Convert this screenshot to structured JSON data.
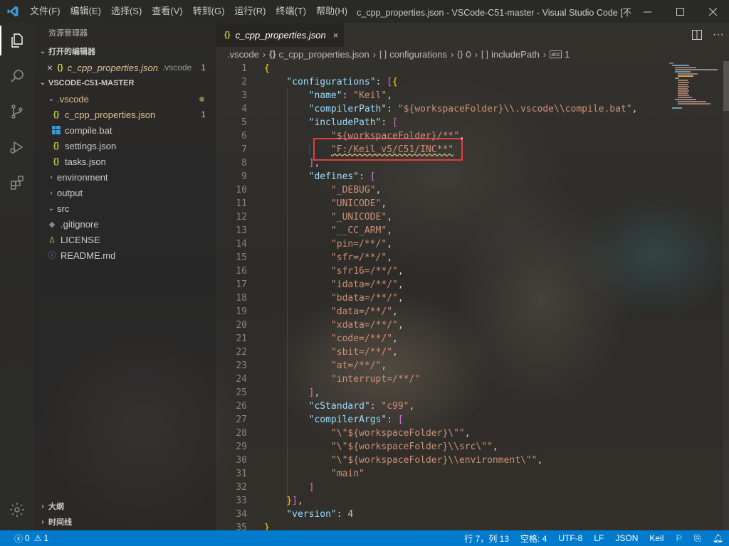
{
  "window": {
    "title": "c_cpp_properties.json - VSCode-C51-master - Visual Studio Code [不...",
    "menu": [
      "文件(F)",
      "编辑(E)",
      "选择(S)",
      "查看(V)",
      "转到(G)",
      "运行(R)",
      "终端(T)",
      "帮助(H)"
    ]
  },
  "sidebar": {
    "header": "资源管理器",
    "open_editors_title": "打开的编辑器",
    "open_editor": {
      "name": "c_cpp_properties.json",
      "folder": ".vscode",
      "problems": "1"
    },
    "workspace_title": "VSCODE-C51-MASTER",
    "tree": [
      {
        "label": ".vscode",
        "type": "folder",
        "badge": "dot"
      },
      {
        "label": "c_cpp_properties.json",
        "type": "json",
        "badge": "1"
      },
      {
        "label": "compile.bat",
        "type": "bat"
      },
      {
        "label": "settings.json",
        "type": "json"
      },
      {
        "label": "tasks.json",
        "type": "json"
      },
      {
        "label": "environment",
        "type": "folder"
      },
      {
        "label": "output",
        "type": "folder"
      },
      {
        "label": "src",
        "type": "folder"
      },
      {
        "label": ".gitignore",
        "type": "git"
      },
      {
        "label": "LICENSE",
        "type": "license"
      },
      {
        "label": "README.md",
        "type": "info"
      }
    ],
    "outline_title": "大纲",
    "timeline_title": "时间线"
  },
  "editor": {
    "tab_label": "c_cpp_properties.json",
    "breadcrumb": [
      ".vscode",
      "c_cpp_properties.json",
      "configurations",
      "0",
      "includePath",
      "1"
    ]
  },
  "code": [
    "{",
    "    \"configurations\": [{",
    "        \"name\": \"Keil\",",
    "        \"compilerPath\": \"${workspaceFolder}\\\\.vscode\\\\compile.bat\",",
    "        \"includePath\": [",
    "            \"${workspaceFolder}/**\",",
    "            \"F:/Keil_v5/C51/INC**\"",
    "        ],",
    "        \"defines\": [",
    "            \"_DEBUG\",",
    "            \"UNICODE\",",
    "            \"_UNICODE\",",
    "            \"__CC_ARM\",",
    "            \"pin=/**/\",",
    "            \"sfr=/**/\",",
    "            \"sfr16=/**/\",",
    "            \"idata=/**/\",",
    "            \"bdata=/**/\",",
    "            \"data=/**/\",",
    "            \"xdata=/**/\",",
    "            \"code=/**/\",",
    "            \"sbit=/**/\",",
    "            \"at=/**/\",",
    "            \"interrupt=/**/\"",
    "        ],",
    "        \"cStandard\": \"c99\",",
    "        \"compilerArgs\": [",
    "            \"\\\"${workspaceFolder}\\\"\",",
    "            \"\\\"${workspaceFolder}\\\\src\\\"\",",
    "            \"\\\"${workspaceFolder}\\\\environment\\\"\",",
    "            \"main\"",
    "        ]",
    "    }],",
    "    \"version\": 4",
    "}"
  ],
  "statusbar": {
    "errors": "0",
    "warnings": "1",
    "position": "行 7，列 13",
    "indent": "空格: 4",
    "encoding": "UTF-8",
    "eol": "LF",
    "language": "JSON",
    "config": "Keil"
  },
  "colors": {
    "statusbar": "#007acc",
    "key": "#9cdcfe",
    "string": "#ce9178",
    "highlight_box": "#e03e3e"
  }
}
